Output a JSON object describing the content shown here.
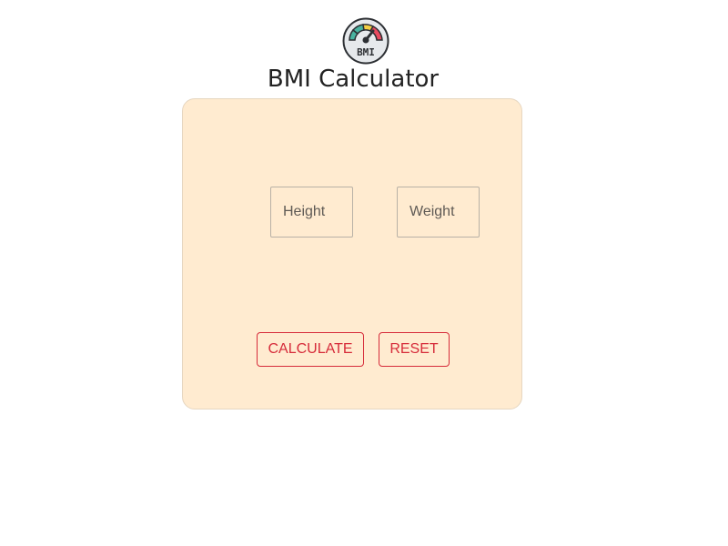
{
  "app": {
    "title": "BMI Calculator",
    "logo_icon": "speedometer-icon",
    "logo_text": "BMI"
  },
  "form": {
    "height_placeholder": "Height",
    "height_value": "",
    "weight_placeholder": "Weight",
    "weight_value": "",
    "calculate_label": "CALCULATE",
    "reset_label": "RESET"
  },
  "colors": {
    "card_background": "#ffebd0",
    "accent": "#d62b3a",
    "title_text": "#222222"
  }
}
